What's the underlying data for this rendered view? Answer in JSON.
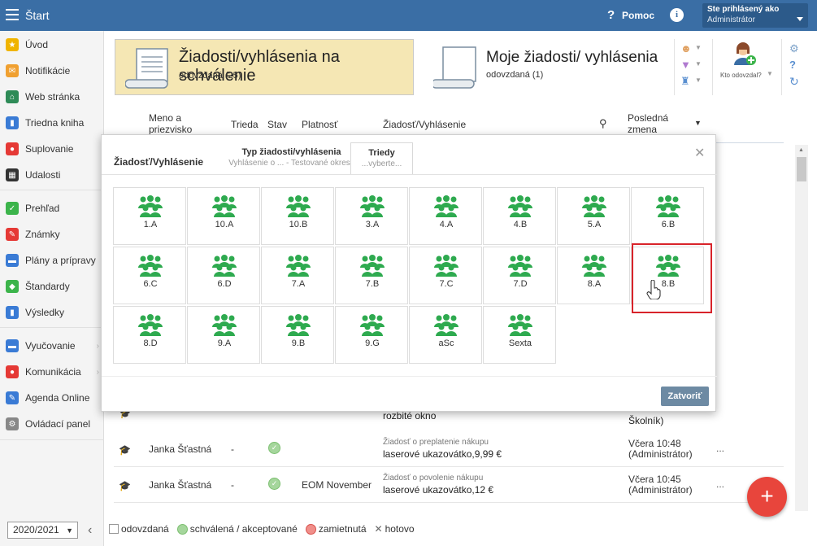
{
  "topbar": {
    "title": "Štart",
    "help_label": "Pomoc",
    "info_glyph": "i",
    "user_line1": "Ste prihlásený ako",
    "user_line2": "Administrátor"
  },
  "sidebar": {
    "items": [
      {
        "label": "Úvod",
        "icon": "star-icon",
        "color": "#f0b400"
      },
      {
        "label": "Notifikácie",
        "icon": "envelope-icon",
        "color": "#f0a030"
      },
      {
        "label": "Web stránka",
        "icon": "house-icon",
        "color": "#2e8b57"
      },
      {
        "label": "Triedna kniha",
        "icon": "book-icon",
        "color": "#3a7bd5"
      },
      {
        "label": "Suplovanie",
        "icon": "person-icon",
        "color": "#e53935"
      },
      {
        "label": "Udalosti",
        "icon": "calendar-icon",
        "color": "#333333"
      },
      {
        "label": "Prehľad",
        "icon": "check-circle-icon",
        "color": "#3cb44b"
      },
      {
        "label": "Známky",
        "icon": "grade-icon",
        "color": "#e53935"
      },
      {
        "label": "Plány a prípravy",
        "icon": "briefcase-icon",
        "color": "#3a7bd5"
      },
      {
        "label": "Štandardy",
        "icon": "shield-icon",
        "color": "#3cb44b"
      },
      {
        "label": "Výsledky",
        "icon": "bar-chart-icon",
        "color": "#3a7bd5"
      },
      {
        "label": "Vyučovanie",
        "icon": "open-book-icon",
        "color": "#3a7bd5"
      },
      {
        "label": "Komunikácia",
        "icon": "chat-icon",
        "color": "#e53935"
      },
      {
        "label": "Agenda Online",
        "icon": "pen-icon",
        "color": "#3a7bd5"
      },
      {
        "label": "Ovládací panel",
        "icon": "gear-icon",
        "color": "#888888"
      }
    ],
    "year": "2020/2021"
  },
  "cards": {
    "approve_title": "Žiadosti/vyhlásenia na schválenie",
    "approve_sub": "odovzdaná (25)",
    "mine_title": "Moje žiadosti/ vyhlásenia",
    "mine_sub": "odovzdaná (1)",
    "kto_label": "Kto odovzdal?"
  },
  "table": {
    "headers": {
      "name": "Meno a priezvisko",
      "class": "Trieda",
      "state": "Stav",
      "validity": "Platnosť",
      "request": "Žiadosť/Vyhlásenie",
      "last_change": "Posledná zmena"
    },
    "partial_row": {
      "req2": "rozbité okno",
      "chg2": "Školník)"
    },
    "rows": [
      {
        "name": "Janka Šťastná",
        "class": "-",
        "validity": "",
        "req1": "Žiadosť o preplatenie nákupu",
        "req2": "laserové ukazovátko,9,99 €",
        "chg1": "Včera 10:48",
        "chg2": "(Administrátor)",
        "more": "..."
      },
      {
        "name": "Janka Šťastná",
        "class": "-",
        "validity": "EOM November",
        "req1": "Žiadosť o povolenie nákupu",
        "req2": "laserové ukazovátko,12 €",
        "chg1": "Včera 10:45",
        "chg2": "(Administrátor)",
        "more": "..."
      }
    ]
  },
  "legend": {
    "submitted": "odovzdaná",
    "approved": "schválená / akceptované",
    "rejected": "zamietnutá",
    "done": "hotovo"
  },
  "modal": {
    "tab0": "Žiadosť/Vyhlásenie",
    "tab1_title": "Typ žiadosti/vyhlásenia",
    "tab1_sub": "Vyhlásenie o ... - Testované okresy",
    "tab2_title": "Triedy",
    "tab2_sub": "...vyberte...",
    "classes": [
      "1.A",
      "10.A",
      "10.B",
      "3.A",
      "4.A",
      "4.B",
      "5.A",
      "6.B",
      "6.C",
      "6.D",
      "7.A",
      "7.B",
      "7.C",
      "7.D",
      "8.A",
      "8.B",
      "8.D",
      "9.A",
      "9.B",
      "9.G",
      "aSc",
      "Sexta"
    ],
    "highlighted": "8.B",
    "close_label": "Zatvoriť",
    "group_color": "#2eaa4f"
  },
  "fab": "+"
}
